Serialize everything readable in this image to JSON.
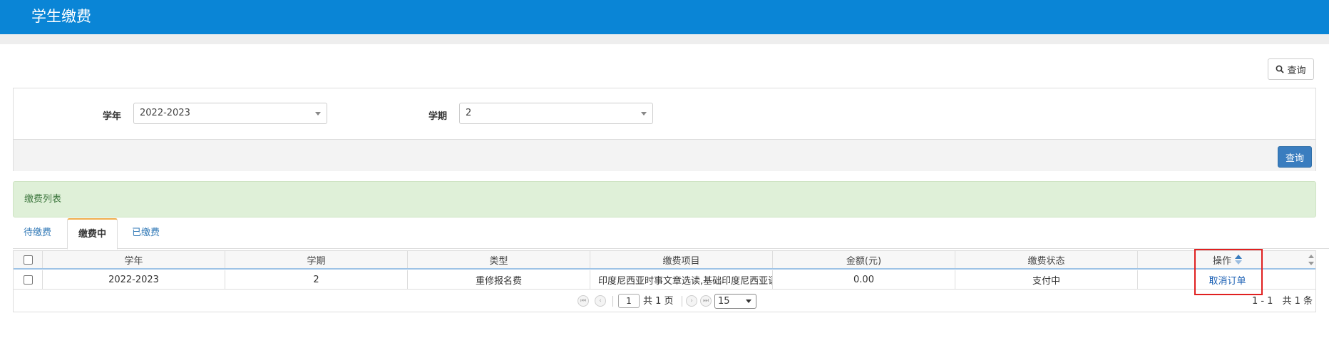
{
  "header": {
    "title": "学生缴费"
  },
  "search": {
    "top_button_label": "查询",
    "submit_label": "查询"
  },
  "filters": {
    "year_label": "学年",
    "year_value": "2022-2023",
    "term_label": "学期",
    "term_value": "2"
  },
  "list": {
    "title": "缴费列表"
  },
  "tabs": [
    {
      "label": "待缴费",
      "active": false
    },
    {
      "label": "缴费中",
      "active": true
    },
    {
      "label": "已缴费",
      "active": false
    }
  ],
  "table": {
    "columns": [
      "学年",
      "学期",
      "类型",
      "缴费项目",
      "金额(元)",
      "缴费状态",
      "操作"
    ],
    "rows": [
      {
        "year": "2022-2023",
        "term": "2",
        "type": "重修报名费",
        "item": "印度尼西亚时事文章选读,基础印度尼西亚语",
        "amount": "0.00",
        "status": "支付中",
        "action": "取消订单"
      }
    ]
  },
  "pager": {
    "current_page": "1",
    "total_pages_text": "共 1 页",
    "page_size": "15",
    "count_text": "1 - 1　共 1 条"
  },
  "colors": {
    "header_bg": "#0a85d6",
    "primary_button": "#3a7dbf",
    "list_header_bg": "#dff0d8",
    "highlight": "#e02020"
  }
}
